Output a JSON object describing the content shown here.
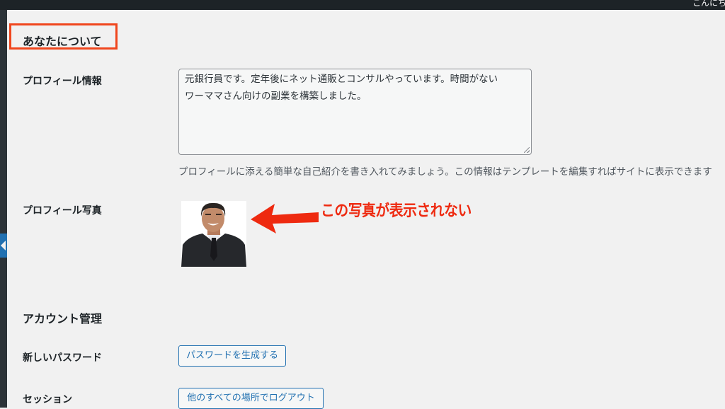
{
  "topbar": {
    "user_text": "こんにち"
  },
  "about_section": {
    "title": "あなたについて",
    "bio_label": "プロフィール情報",
    "bio_value": "元銀行員です。定年後にネット通販とコンサルやっています。時間がない\nワーママさん向けの副業を構築しました。",
    "bio_description": "プロフィールに添える簡単な自己紹介を書き入れてみましょう。この情報はテンプレートを編集すればサイトに表示できます",
    "photo_label": "プロフィール写真",
    "photo_icon": "avatar-photo"
  },
  "annotation": {
    "text": "この写真が表示されない",
    "color": "#ee2a10",
    "highlight_color": "#f0461d"
  },
  "account_section": {
    "title": "アカウント管理",
    "password_label": "新しいパスワード",
    "generate_password_button": "パスワードを生成する",
    "sessions_label": "セッション",
    "logout_everywhere_button": "他のすべての場所でログアウト"
  },
  "colors": {
    "accent": "#2271b1",
    "admin_bar": "#1d2327",
    "background": "#f1f1f1"
  }
}
